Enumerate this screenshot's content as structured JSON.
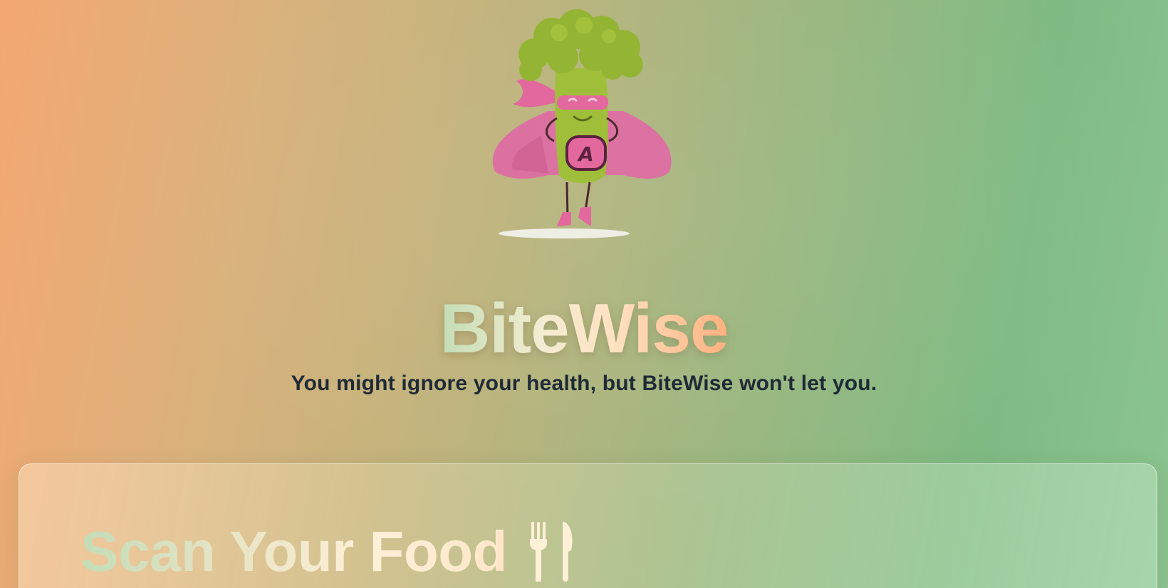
{
  "app": {
    "name": "BiteWise",
    "tagline": "You might ignore your health, but BiteWise won't let you."
  },
  "mascot": {
    "icon": "broccoli-superhero-mascot",
    "badge_letter": "A"
  },
  "scan_card": {
    "title": "Scan Your Food",
    "icon": "fork-knife-icon"
  },
  "colors": {
    "bg_left": "#f5a873",
    "bg_right": "#7fbb84",
    "tagline_text": "#1f2a36",
    "mascot_green": "#9ab53a",
    "mascot_pink": "#e2689d"
  }
}
